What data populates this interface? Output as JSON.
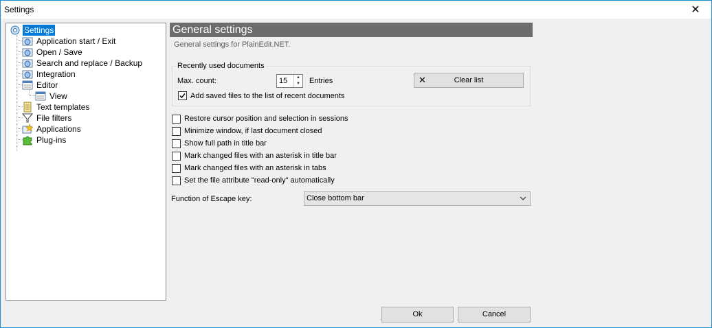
{
  "window": {
    "title": "Settings",
    "close_glyph": "✕"
  },
  "tree": {
    "items": [
      {
        "label": "Settings",
        "icon": "settings-gear-icon",
        "selected": true
      },
      {
        "label": "Application start / Exit",
        "icon": "gear-icon"
      },
      {
        "label": "Open / Save",
        "icon": "gear-icon"
      },
      {
        "label": "Search and replace / Backup",
        "icon": "gear-icon"
      },
      {
        "label": "Integration",
        "icon": "gear-icon"
      },
      {
        "label": "Editor",
        "icon": "window-icon"
      },
      {
        "label": "View",
        "icon": "window-icon"
      },
      {
        "label": "Text templates",
        "icon": "document-icon"
      },
      {
        "label": "File filters",
        "icon": "funnel-icon"
      },
      {
        "label": "Applications",
        "icon": "star-icon"
      },
      {
        "label": "Plug-ins",
        "icon": "puzzle-icon"
      }
    ]
  },
  "panel": {
    "header": "General settings",
    "subtitle": "General settings for PlainEdit.NET."
  },
  "recent": {
    "group_label": "Recently used documents",
    "max_count_label": "Max. count:",
    "max_count_value": "15",
    "entries_label": "Entries",
    "clear_button": "Clear list",
    "add_saved_label": "Add saved files to the list of recent documents",
    "add_saved_checked": true
  },
  "options": [
    {
      "label": "Restore cursor position and selection in sessions",
      "checked": false
    },
    {
      "label": "Minimize window, if last document closed",
      "checked": false
    },
    {
      "label": "Show full path in title bar",
      "checked": false
    },
    {
      "label": "Mark changed files with an asterisk in title bar",
      "checked": false
    },
    {
      "label": "Mark changed files with an asterisk in tabs",
      "checked": false
    },
    {
      "label": "Set the file attribute \"read-only\" automatically",
      "checked": false
    }
  ],
  "escape": {
    "label": "Function of Escape key:",
    "selected": "Close bottom bar"
  },
  "footer": {
    "ok": "Ok",
    "cancel": "Cancel"
  },
  "colors": {
    "selection": "#0078d7",
    "header_bg": "#6d6d6d",
    "window_border": "#1a8fd8"
  }
}
